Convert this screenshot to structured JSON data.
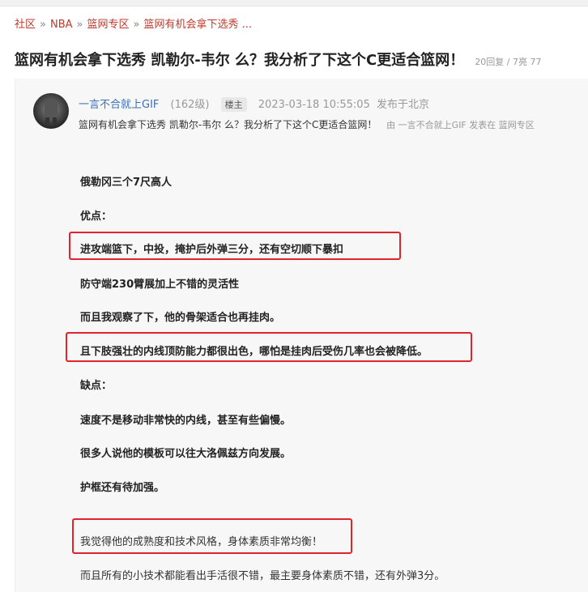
{
  "breadcrumb": {
    "items": [
      "社区",
      "NBA",
      "篮网专区",
      "篮网有机会拿下选秀 ..."
    ],
    "separator": "»"
  },
  "thread": {
    "title": "篮网有机会拿下选秀 凯勒尔-韦尔 么？我分析了下这个C更适合篮网！",
    "stats": "20回复 / 7亮 77"
  },
  "post": {
    "username": "一言不合就上GIF",
    "level": "(162级)",
    "badge": "楼主",
    "time": "2023-03-18 10:55:05",
    "location": "发布于北京",
    "subtitle": "篮网有机会拿下选秀 凯勒尔-韦尔 么？我分析了下这个C更适合篮网！",
    "source": "由 一言不合就上GIF 发表在 篮网专区",
    "paragraphs": [
      "俄勒冈三个7尺高人",
      "优点：",
      "进攻端篮下，中投，掩护后外弹三分，还有空切顺下暴扣",
      "防守端230臂展加上不错的灵活性",
      "而且我观察了下，他的骨架适合也再挂肉。",
      "且下肢强壮的内线顶防能力都很出色，哪怕是挂肉后受伤几率也会被降低。",
      "缺点：",
      "速度不是移动非常快的内线，甚至有些偏慢。",
      "很多人说他的模板可以往大洛佩兹方向发展。",
      "护框还有待加强。",
      "我觉得他的成熟度和技术风格，身体素质非常均衡！",
      "而且所有的小技术都能看出手活很不错，最主要身体素质不错，还有外弹3分。"
    ]
  },
  "colors": {
    "highlight_box": "#e2232b",
    "link": "#c0392b",
    "username": "#3b6fb6"
  }
}
